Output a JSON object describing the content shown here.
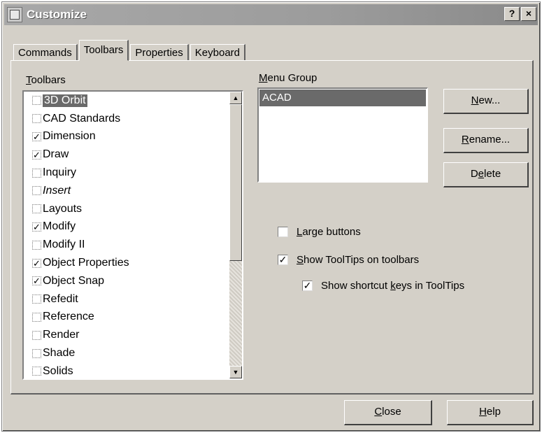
{
  "window": {
    "title": "Customize",
    "help_label": "?",
    "close_label": "×"
  },
  "tabs": [
    {
      "label": "Commands"
    },
    {
      "label": "Toolbars"
    },
    {
      "label": "Properties"
    },
    {
      "label": "Keyboard"
    }
  ],
  "toolbars_list": {
    "label_accel": "T",
    "label_rest": "oolbars",
    "items": [
      {
        "label": "3D Orbit",
        "checked": false,
        "selected": true
      },
      {
        "label": "CAD Standards",
        "checked": false
      },
      {
        "label": "Dimension",
        "checked": true
      },
      {
        "label": "Draw",
        "checked": true
      },
      {
        "label": "Inquiry",
        "checked": false
      },
      {
        "label": "Insert",
        "checked": false
      },
      {
        "label": "Layouts",
        "checked": false
      },
      {
        "label": "Modify",
        "checked": true
      },
      {
        "label": "Modify II",
        "checked": false
      },
      {
        "label": "Object Properties",
        "checked": true
      },
      {
        "label": "Object Snap",
        "checked": true
      },
      {
        "label": "Refedit",
        "checked": false
      },
      {
        "label": "Reference",
        "checked": false
      },
      {
        "label": "Render",
        "checked": false
      },
      {
        "label": "Shade",
        "checked": false
      },
      {
        "label": "Solids",
        "checked": false
      }
    ]
  },
  "menu_group": {
    "label_accel": "M",
    "label_rest": "enu Group",
    "items": [
      {
        "label": "ACAD",
        "selected": true
      }
    ]
  },
  "buttons": {
    "new": {
      "accel": "N",
      "rest": "ew..."
    },
    "rename": {
      "accel": "R",
      "rest": "ename..."
    },
    "delete": {
      "pre": "D",
      "accel": "e",
      "rest": "lete"
    },
    "close": {
      "accel": "C",
      "rest": "lose"
    },
    "help": {
      "accel": "H",
      "rest": "elp"
    }
  },
  "options": {
    "large_buttons": {
      "accel": "L",
      "rest": "arge buttons",
      "checked": false
    },
    "show_tooltips": {
      "accel": "S",
      "rest": "how ToolTips on toolbars",
      "checked": true
    },
    "show_shortcut": {
      "pre": "Show shortcut ",
      "accel": "k",
      "rest": "eys in ToolTips",
      "checked": true
    }
  },
  "check_glyph": "✓"
}
